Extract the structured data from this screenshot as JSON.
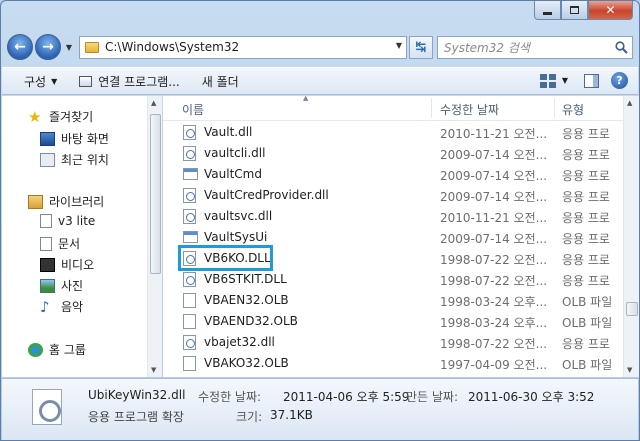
{
  "navbar": {
    "address": "C:\\Windows\\System32",
    "search_placeholder": "System32 검색"
  },
  "commands": {
    "organize": "구성",
    "open_with": "연결 프로그램...",
    "new_folder": "새 폴더"
  },
  "sidebar": {
    "favorites": "즐겨찾기",
    "desktop": "바탕 화면",
    "recent": "최근 위치",
    "libraries": "라이브러리",
    "v3": "v3 lite",
    "documents": "문서",
    "videos": "비디오",
    "pictures": "사진",
    "music": "음악",
    "homegroup": "홈 그룹"
  },
  "columns": {
    "name": "이름",
    "date": "수정한 날짜",
    "type": "유형"
  },
  "files": [
    {
      "name": "Vault.dll",
      "date": "2010-11-21 오전...",
      "type": "응용 프로",
      "icon": "dll"
    },
    {
      "name": "vaultcli.dll",
      "date": "2009-07-14 오전...",
      "type": "응용 프로",
      "icon": "dll"
    },
    {
      "name": "VaultCmd",
      "date": "2009-07-14 오전...",
      "type": "응용 프로",
      "icon": "exe"
    },
    {
      "name": "VaultCredProvider.dll",
      "date": "2009-07-14 오전...",
      "type": "응용 프로",
      "icon": "dll"
    },
    {
      "name": "vaultsvc.dll",
      "date": "2010-11-21 오전...",
      "type": "응용 프로",
      "icon": "dll"
    },
    {
      "name": "VaultSysUi",
      "date": "2009-07-14 오전...",
      "type": "응용 프로",
      "icon": "exe"
    },
    {
      "name": "VB6KO.DLL",
      "date": "1998-07-22 오전...",
      "type": "응용 프로",
      "icon": "dll"
    },
    {
      "name": "VB6STKIT.DLL",
      "date": "1998-07-22 오전...",
      "type": "응용 프로",
      "icon": "dll"
    },
    {
      "name": "VBAEN32.OLB",
      "date": "1998-03-24 오후...",
      "type": "OLB 파일",
      "icon": "file"
    },
    {
      "name": "VBAEND32.OLB",
      "date": "1998-03-24 오후...",
      "type": "OLB 파일",
      "icon": "file"
    },
    {
      "name": "vbajet32.dll",
      "date": "1998-07-22 오전...",
      "type": "응용 프로",
      "icon": "dll"
    },
    {
      "name": "VBAKO32.OLB",
      "date": "1997-04-09 오전...",
      "type": "OLB 파일",
      "icon": "file"
    }
  ],
  "details": {
    "filename": "UbiKeyWin32.dll",
    "filetype": "응용 프로그램 확장",
    "modified_label": "수정한 날짜:",
    "modified_value": "2011-04-06 오후 5:59",
    "created_label": "만든 날짜:",
    "created_value": "2011-06-30 오후 3:52",
    "size_label": "크기:",
    "size_value": "37.1KB"
  },
  "colors": {
    "highlight_box": "#1e9bd9"
  }
}
